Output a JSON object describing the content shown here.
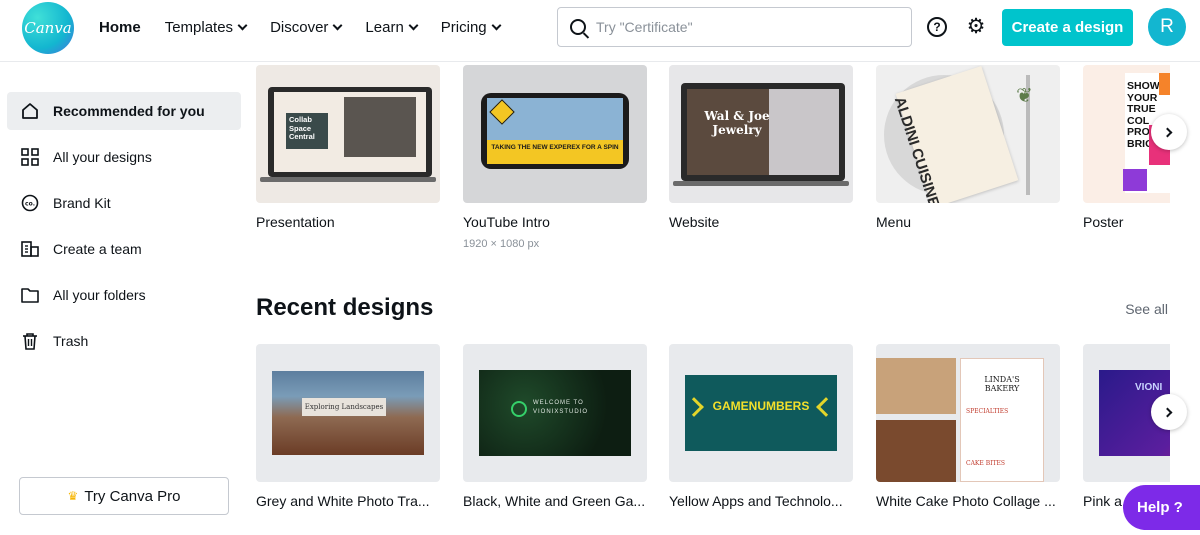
{
  "logo": "Canva",
  "nav": {
    "home": "Home",
    "templates": "Templates",
    "discover": "Discover",
    "learn": "Learn",
    "pricing": "Pricing"
  },
  "search": {
    "placeholder": "Try \"Certificate\""
  },
  "header": {
    "help_icon": "?",
    "create_label": "Create a design",
    "avatar_initial": "R"
  },
  "sidebar": {
    "items": [
      {
        "label": "Recommended for you",
        "icon": "home-icon"
      },
      {
        "label": "All your designs",
        "icon": "grid-icon"
      },
      {
        "label": "Brand Kit",
        "icon": "brand-icon"
      },
      {
        "label": "Create a team",
        "icon": "building-icon"
      },
      {
        "label": "All your folders",
        "icon": "folder-icon"
      },
      {
        "label": "Trash",
        "icon": "trash-icon"
      }
    ],
    "pro_label": "Try Canva Pro"
  },
  "templates": [
    {
      "label": "Presentation",
      "sub": ""
    },
    {
      "label": "YouTube Intro",
      "sub": "1920 × 1080 px"
    },
    {
      "label": "Website",
      "sub": ""
    },
    {
      "label": "Menu",
      "sub": ""
    },
    {
      "label": "Poster",
      "sub": ""
    }
  ],
  "thumb_text": {
    "presentation": "Collab Space Central",
    "youtube": "TAKING THE NEW EXPEREX FOR A SPIN",
    "website": "Wal & Joe Jewelry",
    "menu": "ALDINI CUISINE",
    "poster": "SHOW YOUR TRUE COL PRO BRIG",
    "recent_1": "Exploring Landscapes",
    "recent_2": "WELCOME TO VIONIXSTUDIO",
    "recent_3": "GAMENUMBERS",
    "recent_4": "LINDA'S BAKERY",
    "recent_4_a": "SPECIALTIES",
    "recent_4_b": "CAKE BITES",
    "recent_5": "VIONI"
  },
  "recent": {
    "title": "Recent designs",
    "see_all": "See all",
    "items": [
      {
        "label": "Grey and White Photo Tra..."
      },
      {
        "label": "Black, White and Green Ga..."
      },
      {
        "label": "Yellow Apps and Technolo..."
      },
      {
        "label": "White Cake Photo Collage ..."
      },
      {
        "label": "Pink a..."
      }
    ]
  },
  "help_fab": "Help ?",
  "colors": {
    "accent": "#00c4cc",
    "help": "#7d2ae8"
  }
}
